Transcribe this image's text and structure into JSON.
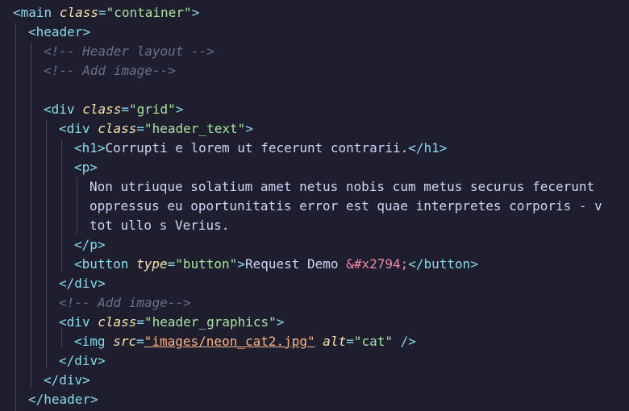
{
  "code": {
    "l1": {
      "tag": "main",
      "attr": "class",
      "value": "\"container\""
    },
    "l2": {
      "tag": "header"
    },
    "l3": {
      "comment": "<!-- Header layout -->"
    },
    "l4": {
      "comment": "<!-- Add image-->"
    },
    "l6": {
      "tag": "div",
      "attr": "class",
      "value": "\"grid\""
    },
    "l7": {
      "tag": "div",
      "attr": "class",
      "value": "\"header_text\""
    },
    "l8": {
      "tag": "h1",
      "text": "Corrupti e lorem ut fecerunt contrarii.",
      "close": "h1"
    },
    "l9": {
      "tag": "p"
    },
    "l10": {
      "text": "Non utriuque solatium amet netus nobis cum metus securus fecerunt"
    },
    "l11": {
      "text": "oppressus eu oportunitatis error est quae interpretes corporis - v"
    },
    "l12": {
      "text": "tot ullo s Verius."
    },
    "l13": {
      "close": "p"
    },
    "l14": {
      "tag": "button",
      "attr": "type",
      "value": "\"button\"",
      "text": "Request Demo ",
      "entity": "&#x2794;",
      "close": "button"
    },
    "l15": {
      "close": "div"
    },
    "l16": {
      "comment": "<!-- Add image-->"
    },
    "l17": {
      "tag": "div",
      "attr": "class",
      "value": "\"header_graphics\""
    },
    "l18": {
      "tag": "img",
      "attr1": "src",
      "value1": "\"images/neon_cat2.jpg\"",
      "attr2": "alt",
      "value2": "\"cat\"",
      "selfclose": "/>"
    },
    "l19": {
      "close": "div"
    },
    "l20": {
      "close": "div"
    },
    "l21": {
      "close": "header"
    }
  }
}
